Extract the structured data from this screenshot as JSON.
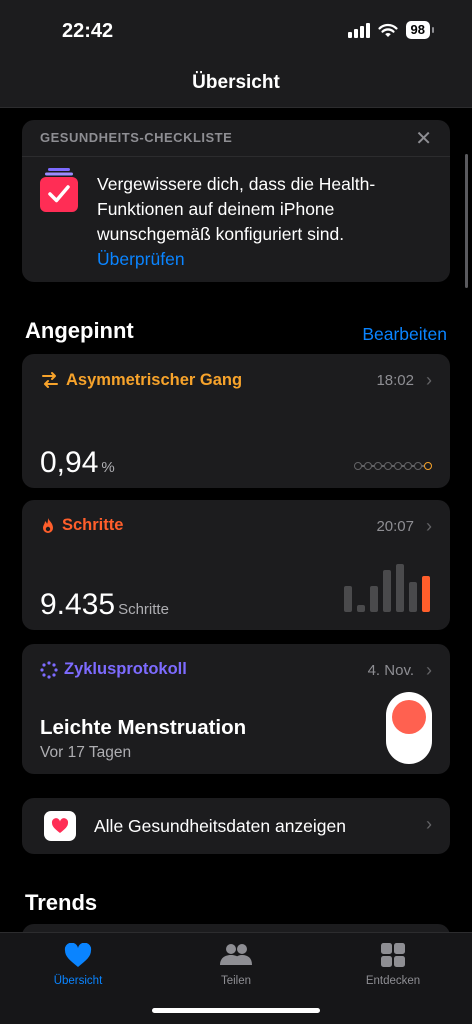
{
  "status_bar": {
    "time": "22:42",
    "battery": "98"
  },
  "nav": {
    "title": "Übersicht"
  },
  "checklist": {
    "header": "GESUNDHEITS-CHECKLISTE",
    "close": "✕",
    "text": "Vergewissere dich, dass die Health-Funktionen auf deinem iPhone wunschgemäß konfiguriert sind.",
    "link": "Überprüfen"
  },
  "pinned": {
    "title": "Angepinnt",
    "edit": "Bearbeiten",
    "cards": [
      {
        "title": "Asymmetrischer Gang",
        "time": "18:02",
        "value": "0,94",
        "unit": "%",
        "color": "#f7a32b",
        "icon": "arrows-icon"
      },
      {
        "title": "Schritte",
        "time": "20:07",
        "value": "9.435",
        "unit": "Schritte",
        "color": "#ff5e2b",
        "icon": "flame-icon",
        "bar_levels": [
          0.55,
          0.15,
          0.55,
          0.88,
          1.0,
          0.62,
          0.76
        ]
      },
      {
        "title": "Zyklusprotokoll",
        "time": "4. Nov.",
        "main": "Leichte Menstruation",
        "sub": "Vor 17 Tagen",
        "color": "#7d6bff",
        "icon": "cycle-icon"
      }
    ]
  },
  "all_data": {
    "label": "Alle Gesundheitsdaten anzeigen",
    "icon": "heart-icon"
  },
  "trends": {
    "title": "Trends"
  },
  "tabs": [
    {
      "label": "Übersicht",
      "icon": "heart-icon",
      "active": true
    },
    {
      "label": "Teilen",
      "icon": "people-icon",
      "active": false
    },
    {
      "label": "Entdecken",
      "icon": "grid-icon",
      "active": false
    }
  ]
}
